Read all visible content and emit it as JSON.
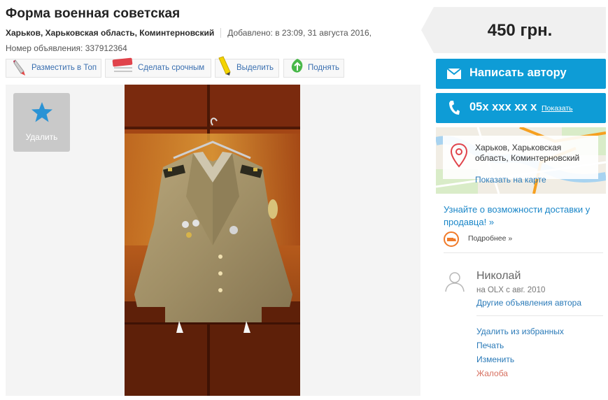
{
  "listing": {
    "title": "Форма военная советская",
    "location": "Харьков, Харьковская область, Коминтерновский",
    "added": "Добавлено: в 23:09, 31 августа 2016,",
    "ad_number": "Номер объявления: 337912364"
  },
  "promo_buttons": [
    {
      "label": "Разместить в Топ",
      "icon": "rocket-icon"
    },
    {
      "label": "Сделать срочным",
      "icon": "urgent-sticker-icon"
    },
    {
      "label": "Выделить",
      "icon": "highlighter-icon"
    },
    {
      "label": "Поднять",
      "icon": "raise-up-icon"
    }
  ],
  "gallery": {
    "favorite_label": "Удалить",
    "favorite_icon": "star-icon",
    "photo_icon": "military-jacket-photo"
  },
  "price": "450 грн.",
  "contact": {
    "message_label": "Написать автору",
    "message_icon": "envelope-icon",
    "phone_number": "05x xxx xx x",
    "phone_show": "Показать",
    "phone_icon": "phone-icon"
  },
  "map": {
    "address": "Харьков, Харьковская область, Коминтерновский",
    "show_on_map": "Показать на карте",
    "pin_icon": "map-pin-icon"
  },
  "delivery": {
    "text": "Узнайте о возможности доставки у продавца! »",
    "more": "Подробнее »",
    "icon": "delivery-truck-icon"
  },
  "seller": {
    "name": "Николай",
    "since": "на OLX с авг. 2010",
    "other_ads": "Другие объявления автора",
    "avatar_icon": "user-avatar-icon"
  },
  "actions": {
    "remove_fav": "Удалить из избранных",
    "print": "Печать",
    "edit": "Изменить",
    "complaint": "Жалоба"
  },
  "colors": {
    "accent_blue": "#0e9cd6",
    "link_blue": "#2a7ab8",
    "complaint": "#d77060",
    "price_bg": "#f0f0f0"
  }
}
